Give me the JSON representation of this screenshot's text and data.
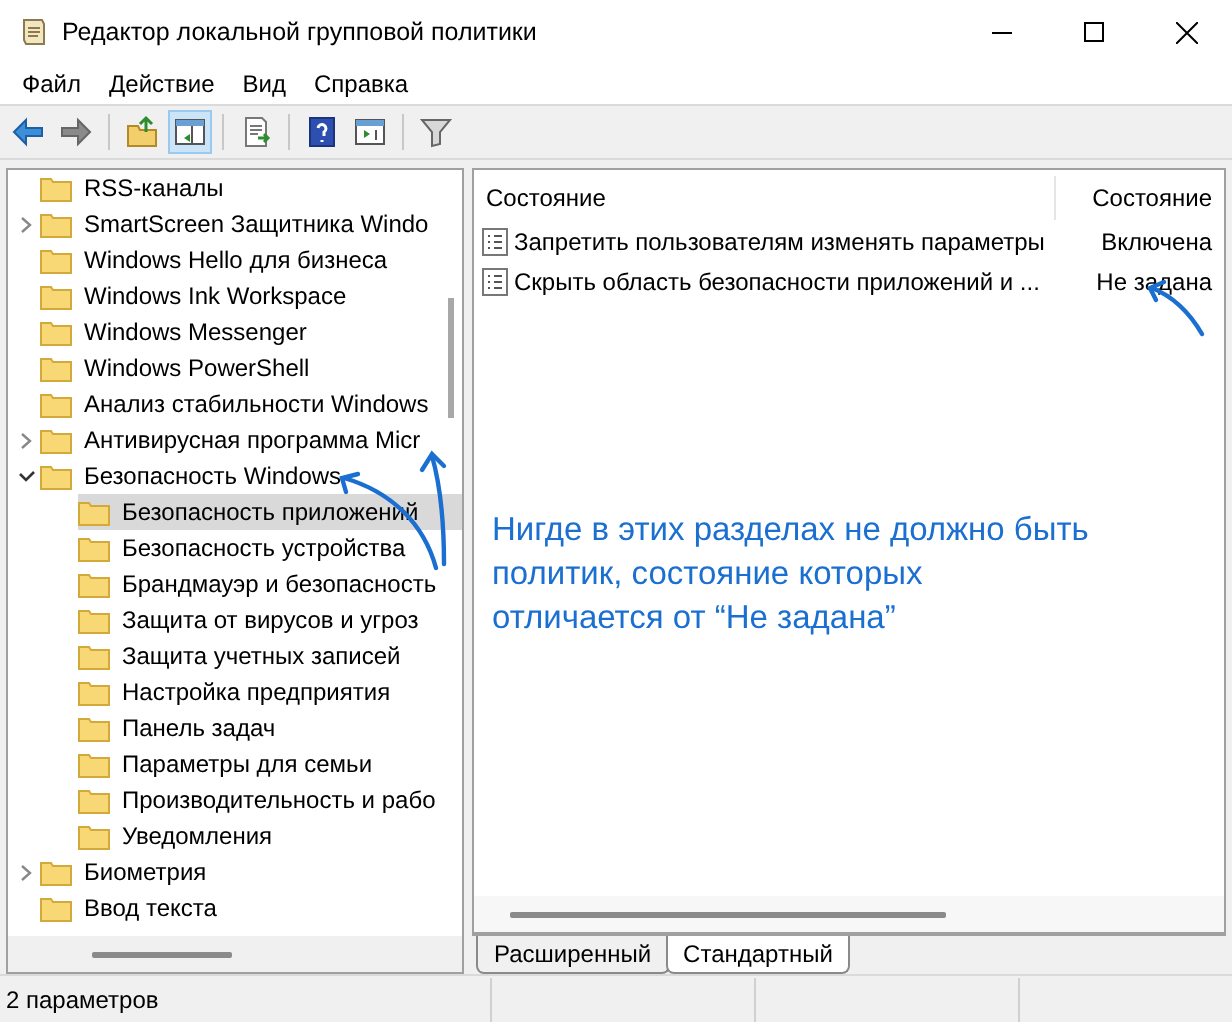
{
  "window": {
    "title": "Редактор локальной групповой политики"
  },
  "menu": [
    "Файл",
    "Действие",
    "Вид",
    "Справка"
  ],
  "toolbar": [
    {
      "kind": "back",
      "pressed": false
    },
    {
      "kind": "forward",
      "pressed": false
    },
    {
      "kind": "sep"
    },
    {
      "kind": "folder-up",
      "pressed": false
    },
    {
      "kind": "tree-toggle",
      "pressed": true
    },
    {
      "kind": "sep"
    },
    {
      "kind": "export",
      "pressed": false
    },
    {
      "kind": "sep"
    },
    {
      "kind": "help",
      "pressed": false
    },
    {
      "kind": "properties",
      "pressed": false
    },
    {
      "kind": "sep"
    },
    {
      "kind": "filter",
      "pressed": false
    }
  ],
  "tree": [
    {
      "label": "RSS-каналы",
      "selected": false
    },
    {
      "label": "SmartScreen Защитника Windo",
      "selected": false,
      "expanded": false
    },
    {
      "label": "Windows Hello для бизнеса",
      "selected": false
    },
    {
      "label": "Windows Ink Workspace",
      "selected": false
    },
    {
      "label": "Windows Messenger",
      "selected": false
    },
    {
      "label": "Windows PowerShell",
      "selected": false
    },
    {
      "label": "Анализ стабильности Windows",
      "selected": false
    },
    {
      "label": "Антивирусная программа Micr",
      "selected": false,
      "expanded": false
    },
    {
      "label": "Безопасность Windows",
      "selected": false,
      "expanded": true,
      "children": [
        {
          "label": "Безопасность приложений",
          "selected": true
        },
        {
          "label": "Безопасность устройства",
          "selected": false
        },
        {
          "label": "Брандмауэр и безопасность",
          "selected": false
        },
        {
          "label": "Защита от вирусов и угроз",
          "selected": false
        },
        {
          "label": "Защита учетных записей",
          "selected": false
        },
        {
          "label": "Настройка предприятия",
          "selected": false
        },
        {
          "label": "Панель задач",
          "selected": false
        },
        {
          "label": "Параметры для семьи",
          "selected": false
        },
        {
          "label": "Производительность и рабо",
          "selected": false
        },
        {
          "label": "Уведомления",
          "selected": false
        }
      ]
    },
    {
      "label": "Биометрия",
      "selected": false,
      "expanded": false
    },
    {
      "label": "Ввод текста",
      "selected": false
    }
  ],
  "table": {
    "columns": [
      "Состояние",
      "Состояние"
    ],
    "rows": [
      {
        "name": "Запретить пользователям изменять параметры",
        "state": "Включена"
      },
      {
        "name": "Скрыть область безопасности приложений и ...",
        "state": "Не задана"
      }
    ]
  },
  "annotation": "Нигде в этих разделах не должно быть\nполитик, состояние которых\nотличается от “Не задана”",
  "tabs": [
    {
      "label": "Расширенный",
      "selected": false
    },
    {
      "label": "Стандартный",
      "selected": true
    }
  ],
  "status_bar": "2 параметров"
}
